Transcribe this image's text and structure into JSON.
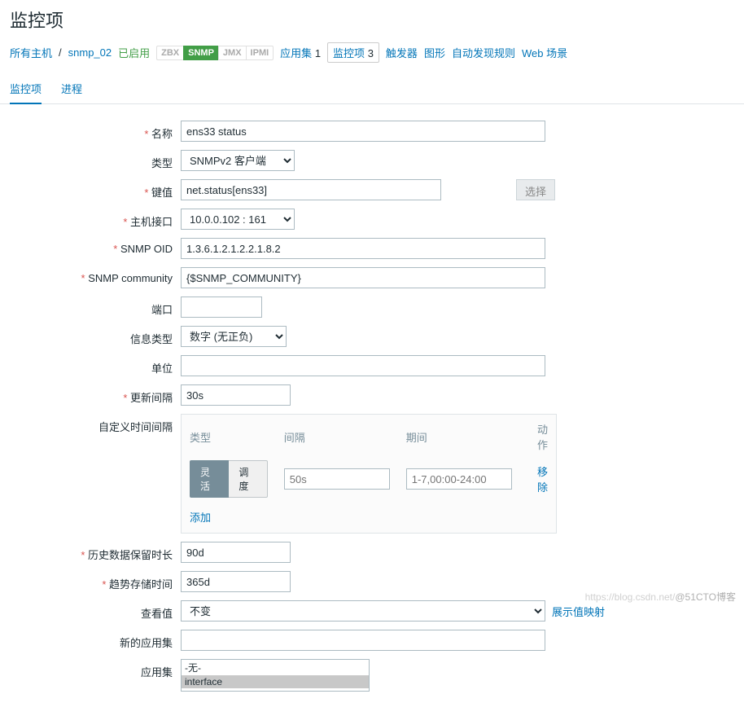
{
  "title": "监控项",
  "breadcrumb": {
    "all_hosts": "所有主机",
    "host": "snmp_02",
    "status": "已启用",
    "badges": {
      "zbx": "ZBX",
      "snmp": "SNMP",
      "jmx": "JMX",
      "ipmi": "IPMI"
    },
    "links": {
      "apps": "应用集",
      "apps_count": "1",
      "items": "监控项",
      "items_count": "3",
      "triggers": "触发器",
      "graphs": "图形",
      "discovery": "自动发现规则",
      "web": "Web 场景"
    }
  },
  "tabs": {
    "items": "监控项",
    "process": "进程"
  },
  "form": {
    "name_label": "名称",
    "name_value": "ens33 status",
    "type_label": "类型",
    "type_value": "SNMPv2 客户端",
    "key_label": "键值",
    "key_value": "net.status[ens33]",
    "key_select_btn": "选择",
    "iface_label": "主机接口",
    "iface_value": "10.0.0.102 : 161",
    "oid_label": "SNMP OID",
    "oid_value": "1.3.6.1.2.1.2.2.1.8.2",
    "community_label": "SNMP community",
    "community_value": "{$SNMP_COMMUNITY}",
    "port_label": "端口",
    "port_value": "",
    "info_label": "信息类型",
    "info_value": "数字 (无正负)",
    "unit_label": "单位",
    "unit_value": "",
    "update_label": "更新间隔",
    "update_value": "30s",
    "custom_label": "自定义时间间隔",
    "interval_headers": {
      "type": "类型",
      "interval": "间隔",
      "period": "期间",
      "action": "动作"
    },
    "interval_row": {
      "flex": "灵活",
      "sched": "调度",
      "interval_ph": "50s",
      "period_ph": "1-7,00:00-24:00",
      "remove": "移除"
    },
    "interval_add": "添加",
    "history_label": "历史数据保留时长",
    "history_value": "90d",
    "trend_label": "趋势存储时间",
    "trend_value": "365d",
    "view_label": "查看值",
    "view_value": "不变",
    "view_link": "展示值映射",
    "newapp_label": "新的应用集",
    "newapp_value": "",
    "app_label": "应用集",
    "app_opts": {
      "none": "-无-",
      "iface": "interface"
    }
  },
  "watermark": {
    "url": "https://blog.csdn.net/",
    "brand": "@51CTO博客"
  }
}
